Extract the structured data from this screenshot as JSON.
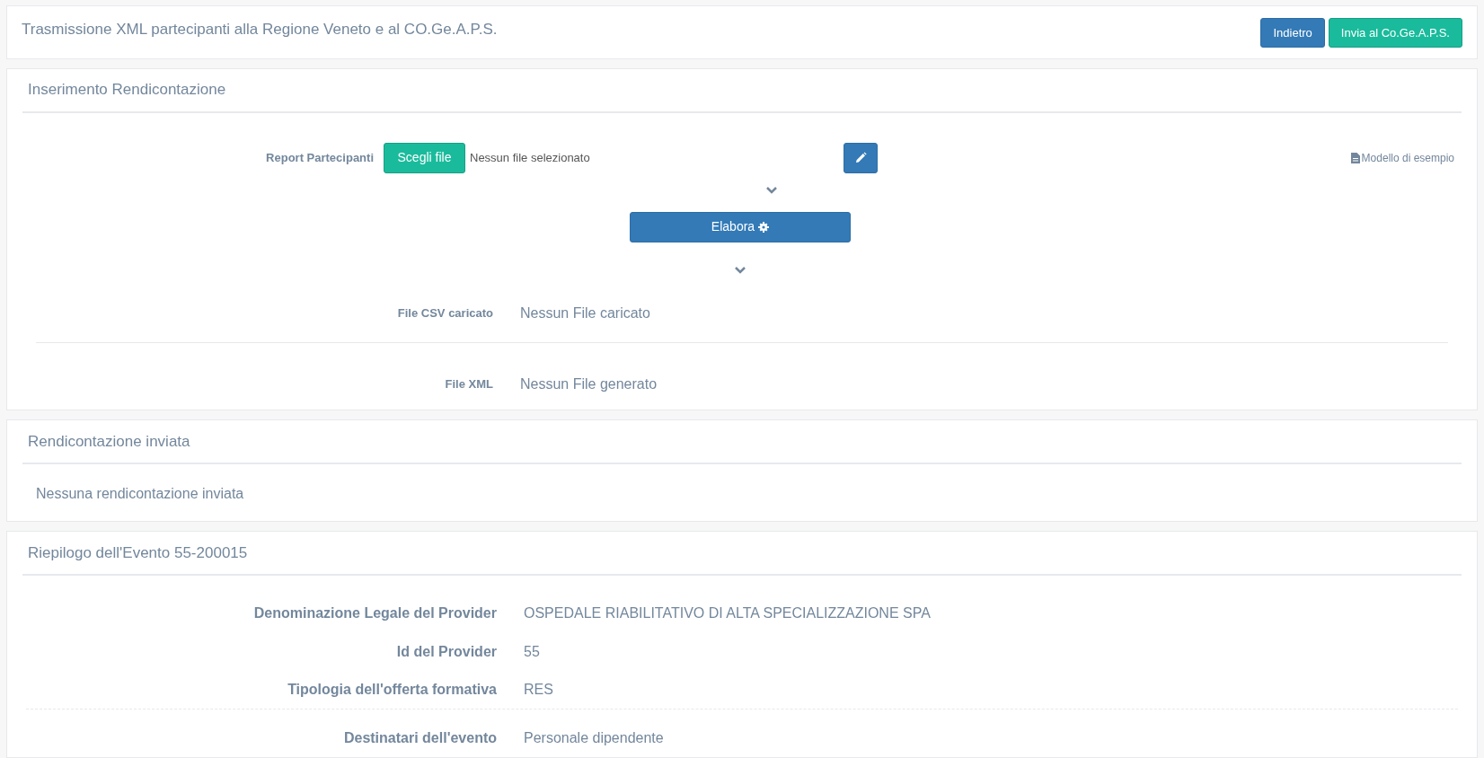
{
  "header": {
    "title": "Trasmissione XML partecipanti alla Regione Veneto e al CO.Ge.A.P.S.",
    "buttons": [
      {
        "label": "Indietro",
        "kind": "primary"
      },
      {
        "label": "Invia al Co.Ge.A.P.S.",
        "kind": "success"
      }
    ]
  },
  "upload": {
    "title": "Inserimento Rendicontazione",
    "report_label": "Report Partecipanti",
    "choose_button": "Scegli file",
    "file_status": "Nessun file selezionato",
    "template_link": "Modello di esempio",
    "process_button": "Elabora",
    "files": [
      {
        "label": "File CSV caricato",
        "value": "Nessun File caricato"
      },
      {
        "label": "File XML",
        "value": "Nessun File generato"
      }
    ]
  },
  "sent": {
    "title": "Rendicontazione inviata",
    "message": "Nessuna rendicontazione inviata"
  },
  "summary": {
    "title": "Riepilogo dell'Evento 55-200015",
    "rows": [
      {
        "label": "Denominazione Legale del Provider",
        "value": "OSPEDALE RIABILITATIVO DI ALTA SPECIALIZZAZIONE SPA",
        "divider_after": false
      },
      {
        "label": "Id del Provider",
        "value": "55",
        "divider_after": false
      },
      {
        "label": "Tipologia dell'offerta formativa",
        "value": "RES",
        "divider_after": true
      },
      {
        "label": "Destinatari dell'evento",
        "value": "Personale dipendente",
        "divider_after": false
      }
    ]
  }
}
